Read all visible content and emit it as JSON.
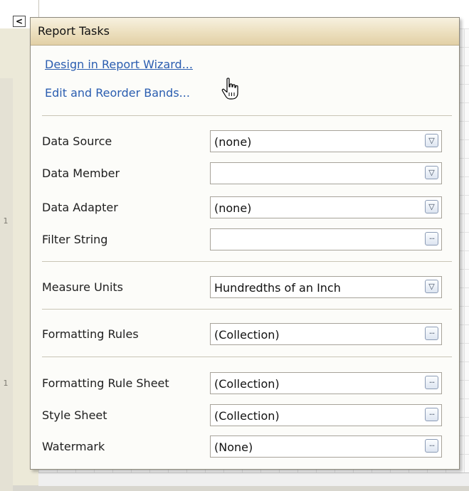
{
  "smart_tag": {
    "glyph": "<"
  },
  "panel": {
    "title": "Report Tasks",
    "links": {
      "wizard": "Design in Report Wizard...",
      "bands": "Edit and Reorder Bands..."
    },
    "groups": [
      [
        {
          "label": "Data Source",
          "value": "(none)",
          "button": "dropdown"
        },
        {
          "label": "Data Member",
          "value": "",
          "button": "dropdown"
        },
        {
          "label": "Data Adapter",
          "value": "(none)",
          "button": "dropdown"
        },
        {
          "label": "Filter String",
          "value": "",
          "button": "ellipsis"
        }
      ],
      [
        {
          "label": "Measure Units",
          "value": "Hundredths of an Inch",
          "button": "dropdown"
        }
      ],
      [
        {
          "label": "Formatting Rules",
          "value": "(Collection)",
          "button": "ellipsis"
        }
      ],
      [
        {
          "label": "Formatting Rule Sheet",
          "value": "(Collection)",
          "button": "ellipsis"
        },
        {
          "label": "Style Sheet",
          "value": "(Collection)",
          "button": "ellipsis"
        },
        {
          "label": "Watermark",
          "value": "(None)",
          "button": "ellipsis"
        }
      ]
    ]
  },
  "glyphs": {
    "dropdown": "▽",
    "ellipsis": "···"
  },
  "ruler": {
    "marks": [
      "1",
      "1"
    ]
  },
  "colors": {
    "link": "#2a5db0",
    "header_gradient_bottom": "#e2d0a6",
    "panel_border": "#8e8a7d"
  }
}
